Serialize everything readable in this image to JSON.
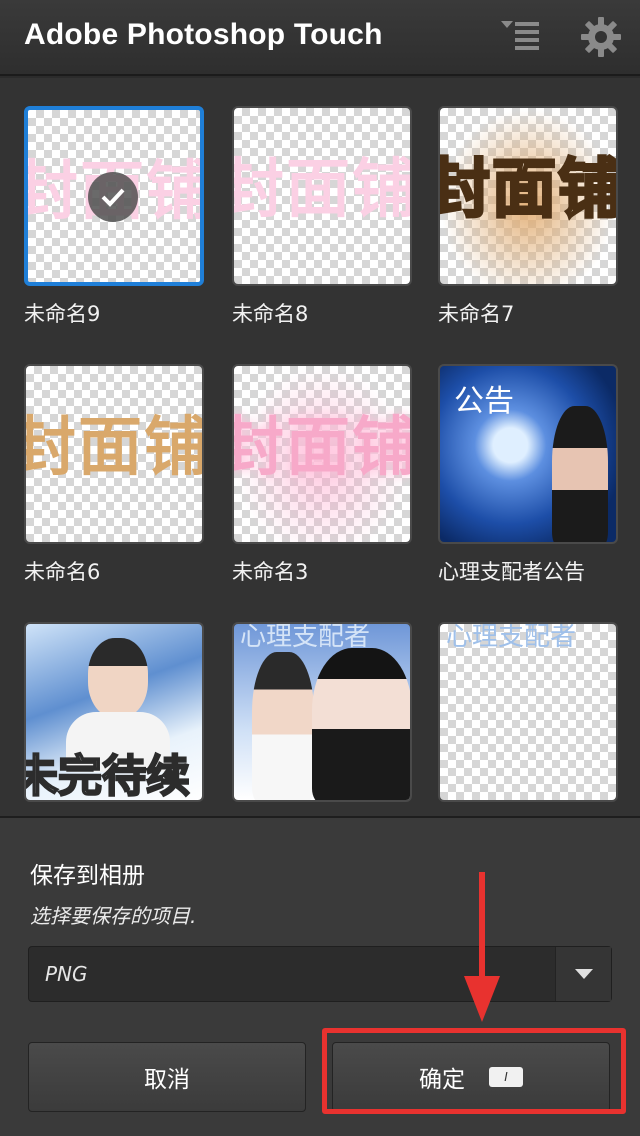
{
  "app": {
    "title": "Adobe Photoshop Touch"
  },
  "toolbar": {
    "sort_icon": "sort-list-icon",
    "settings_icon": "gear-icon"
  },
  "projects": [
    {
      "name": "未命名9",
      "thumb_text": "封面铺",
      "selected": true
    },
    {
      "name": "未命名8",
      "thumb_text": "封面铺"
    },
    {
      "name": "未命名7",
      "thumb_text": "封面铺"
    },
    {
      "name": "未命名6",
      "thumb_text": "封面铺"
    },
    {
      "name": "未命名3",
      "thumb_text": "封面铺"
    },
    {
      "name": "心理支配者公告",
      "thumb_text": "公告"
    },
    {
      "thumb_text": "未完待续"
    },
    {
      "thumb_text": "心理支配者"
    },
    {
      "thumb_text": "心理支配者"
    }
  ],
  "dialog": {
    "title": "保存到相册",
    "subtitle": "选择要保存的项目.",
    "format_selected": "PNG",
    "cancel_label": "取消",
    "ok_label": "确定",
    "ok_badge": "I"
  },
  "colors": {
    "accent": "#1f7fd8",
    "highlight": "#e8322f"
  }
}
